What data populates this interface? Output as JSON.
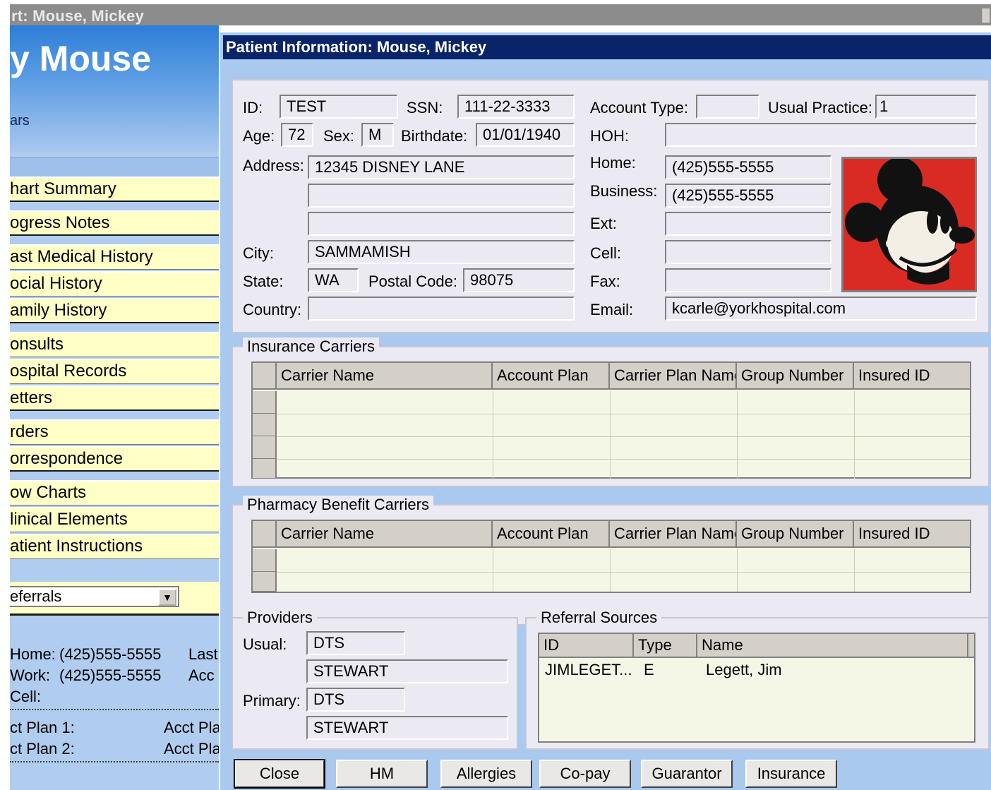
{
  "outer_window": {
    "title": "rt: Mouse, Mickey"
  },
  "left_panel": {
    "patient_name": "y Mouse",
    "age_text": "ars",
    "nav_items": [
      "hart Summary",
      "ogress Notes",
      "ast Medical History",
      "ocial History",
      "amily History",
      "onsults",
      "ospital Records",
      "etters",
      "rders",
      "orrespondence",
      "ow Charts",
      "linical Elements",
      "atient Instructions"
    ],
    "dropdown_value": "eferrals",
    "contact": {
      "home_label": "Home:",
      "home_value": "(425)555-5555",
      "work_label": "Work:",
      "work_value": "(425)555-5555",
      "cell_label": "Cell:",
      "last_label": "Last",
      "acct_label": "Acc",
      "acct_plan1": "ct Plan 1:",
      "acct_plan2": "ct Plan 2:",
      "acct_pla1": "Acct Pla",
      "acct_pla2": "Acct Pla"
    }
  },
  "dialog": {
    "title": "Patient Information: Mouse, Mickey",
    "labels": {
      "id": "ID:",
      "ssn": "SSN:",
      "account_type": "Account Type:",
      "usual_practice": "Usual Practice:",
      "age": "Age:",
      "sex": "Sex:",
      "birthdate": "Birthdate:",
      "hoh": "HOH:",
      "address": "Address:",
      "home": "Home:",
      "business": "Business:",
      "ext": "Ext:",
      "city": "City:",
      "cell": "Cell:",
      "state": "State:",
      "postal_code": "Postal Code:",
      "fax": "Fax:",
      "country": "Country:",
      "email": "Email:"
    },
    "values": {
      "id": "TEST",
      "ssn": "111-22-3333",
      "account_type": "",
      "usual_practice": "1",
      "age": "72",
      "sex": "M",
      "birthdate": "01/01/1940",
      "hoh": "",
      "address1": "12345  DISNEY LANE",
      "address2": "",
      "address3": "",
      "home": "(425)555-5555",
      "business": "(425)555-5555",
      "ext": "",
      "cell": "",
      "fax": "",
      "city": "SAMMAMISH",
      "state": "WA",
      "postal_code": "98075",
      "country": "",
      "email": "kcarle@yorkhospital.com"
    },
    "insurance": {
      "title": "Insurance Carriers",
      "columns": [
        "Carrier Name",
        "Account Plan",
        "Carrier Plan Name",
        "Group Number",
        "Insured ID"
      ]
    },
    "pharmacy": {
      "title": "Pharmacy Benefit Carriers",
      "columns": [
        "Carrier Name",
        "Account Plan",
        "Carrier Plan Name",
        "Group Number",
        "Insured ID"
      ]
    },
    "providers": {
      "title": "Providers",
      "usual_label": "Usual:",
      "usual_code": "DTS",
      "usual_name": "STEWART",
      "primary_label": "Primary:",
      "primary_code": "DTS",
      "primary_name": "STEWART"
    },
    "referrals": {
      "title": "Referral Sources",
      "columns": [
        "ID",
        "Type",
        "Name"
      ],
      "rows": [
        {
          "id": "JIMLEGET...",
          "type": "E",
          "name": "Legett, Jim"
        }
      ]
    },
    "buttons": [
      "Close",
      "HM",
      "Allergies",
      "Co-pay",
      "Guarantor",
      "Insurance"
    ]
  }
}
